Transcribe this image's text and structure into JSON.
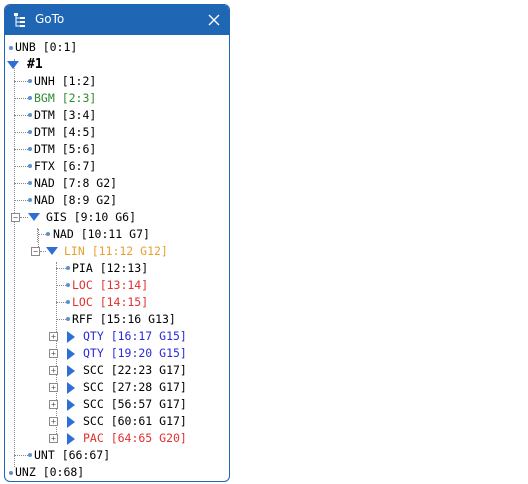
{
  "window": {
    "title": "GoTo",
    "close_icon": "close-icon",
    "app_icon": "goto-icon"
  },
  "colors": {
    "titlebar": "#1f67b5",
    "default": "#1a1a1a",
    "green": "#2e8b2e",
    "orange": "#e8a030",
    "red": "#e03030",
    "blue": "#2a2ad8"
  },
  "tree": [
    {
      "id": "unb",
      "label": "UNB [0:1]",
      "color": "default"
    },
    {
      "id": "g1",
      "label": "#1",
      "color": "default",
      "bold": true
    },
    {
      "id": "unh",
      "label": "UNH [1:2]",
      "color": "default"
    },
    {
      "id": "bgm",
      "label": "BGM [2:3]",
      "color": "green"
    },
    {
      "id": "dtm1",
      "label": "DTM [3:4]",
      "color": "default"
    },
    {
      "id": "dtm2",
      "label": "DTM [4:5]",
      "color": "default"
    },
    {
      "id": "dtm3",
      "label": "DTM [5:6]",
      "color": "default"
    },
    {
      "id": "ftx",
      "label": "FTX [6:7]",
      "color": "default"
    },
    {
      "id": "nad1",
      "label": "NAD [7:8 G2]",
      "color": "default"
    },
    {
      "id": "nad2",
      "label": "NAD [8:9 G2]",
      "color": "default"
    },
    {
      "id": "gis",
      "label": "GIS [9:10 G6]",
      "color": "default"
    },
    {
      "id": "nad3",
      "label": "NAD [10:11 G7]",
      "color": "default"
    },
    {
      "id": "lin",
      "label": "LIN [11:12 G12]",
      "color": "orange"
    },
    {
      "id": "pia",
      "label": "PIA [12:13]",
      "color": "default"
    },
    {
      "id": "loc1",
      "label": "LOC [13:14]",
      "color": "red"
    },
    {
      "id": "loc2",
      "label": "LOC [14:15]",
      "color": "red"
    },
    {
      "id": "rff",
      "label": "RFF [15:16 G13]",
      "color": "default"
    },
    {
      "id": "qty1",
      "label": "QTY [16:17 G15]",
      "color": "blue"
    },
    {
      "id": "qty2",
      "label": "QTY [19:20 G15]",
      "color": "blue"
    },
    {
      "id": "scc1",
      "label": "SCC [22:23 G17]",
      "color": "default"
    },
    {
      "id": "scc2",
      "label": "SCC [27:28 G17]",
      "color": "default"
    },
    {
      "id": "scc3",
      "label": "SCC [56:57 G17]",
      "color": "default"
    },
    {
      "id": "scc4",
      "label": "SCC [60:61 G17]",
      "color": "default"
    },
    {
      "id": "pac",
      "label": "PAC [64:65 G20]",
      "color": "red"
    },
    {
      "id": "unt",
      "label": "UNT [66:67]",
      "color": "default"
    },
    {
      "id": "unz",
      "label": "UNZ [0:68]",
      "color": "default"
    }
  ]
}
